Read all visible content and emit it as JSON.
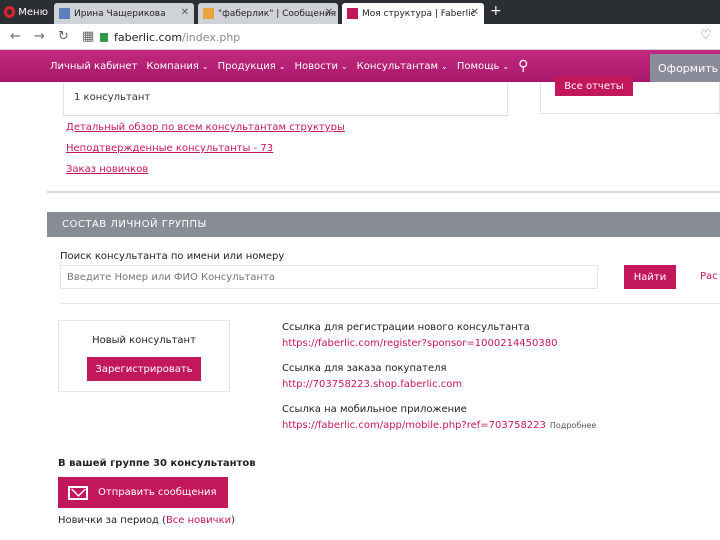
{
  "browser": {
    "menu_label": "Меню",
    "tabs": [
      {
        "title": "Ирина Чащерикова"
      },
      {
        "title": "\"фаберлик\" | Сообщения"
      },
      {
        "title": "Моя структура | Faberlic"
      }
    ],
    "url_main": "faberlic.com",
    "url_path": "/index.php"
  },
  "sitenav": {
    "items": [
      "Личный кабинет",
      "Компания",
      "Продукция",
      "Новости",
      "Консультантам",
      "Помощь"
    ],
    "checkout_label": "Оформить з"
  },
  "top": {
    "box_text": "1 консультант",
    "all_reports": "Все отчеты",
    "links": [
      "Детальный обзор по всем консультантам структуры",
      "Неподтвержденные консультанты - 73",
      "Заказ новичков"
    ]
  },
  "group": {
    "section_title": "СОСТАВ ЛИЧНОЙ ГРУППЫ",
    "search_label": "Поиск консультанта по имени или номеру",
    "search_placeholder": "Введите Номер или ФИО Консультанта",
    "find_label": "Найти",
    "ext_label": "Рас",
    "new_consultant_title": "Новый консультант",
    "register_label": "Зарегистрировать",
    "links": [
      {
        "label": "Ссылка для регистрации нового консультанта",
        "url": "https://faberlic.com/register?sponsor=1000214450380"
      },
      {
        "label": "Ссылка для заказа покупателя",
        "url": "http://703758223.shop.faberlic.com"
      },
      {
        "label": "Ссылка на мобильное приложение",
        "url": "https://faberlic.com/app/mobile.php?ref=703758223",
        "more": "Подробнее"
      }
    ],
    "count_text": "В вашей группе 30 консультантов",
    "send_label": "Отправить сообщения",
    "newbies_prefix": "Новички за период (",
    "newbies_link": "Все новички",
    "newbies_suffix": ")"
  }
}
